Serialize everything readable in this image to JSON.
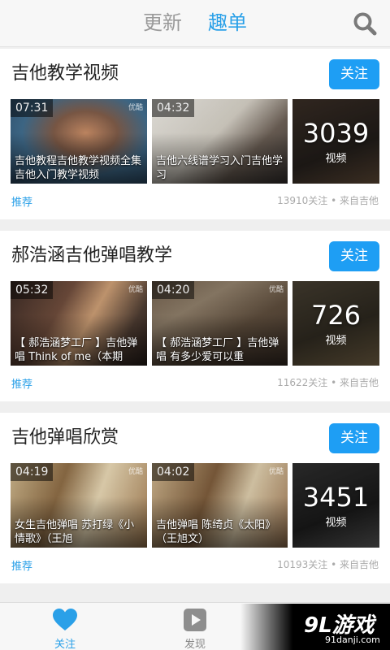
{
  "header": {
    "tab_update": "更新",
    "tab_list": "趣单",
    "accent": "#2aa0e8"
  },
  "cards": [
    {
      "title": "吉他教学视频",
      "follow_label": "关注",
      "videos": [
        {
          "duration": "07:31",
          "logo": "优酷",
          "caption": "吉他教程吉他教学视频全集吉他入门教学视频"
        },
        {
          "duration": "04:32",
          "caption": "吉他六线谱学习入门吉他学习"
        }
      ],
      "video_count": "3039",
      "video_count_label": "视频",
      "tag": "推荐",
      "meta": "13910关注 • 来自吉他"
    },
    {
      "title": "郝浩涵吉他弹唱教学",
      "follow_label": "关注",
      "videos": [
        {
          "duration": "05:32",
          "logo": "优酷",
          "caption": "【 郝浩涵梦工厂 】吉他弹唱 Think of me（本期"
        },
        {
          "duration": "04:20",
          "logo": "优酷",
          "caption": "【 郝浩涵梦工厂 】吉他弹唱 有多少爱可以重"
        }
      ],
      "video_count": "726",
      "video_count_label": "视频",
      "tag": "推荐",
      "meta": "11622关注 • 来自吉他"
    },
    {
      "title": "吉他弹唱欣赏",
      "follow_label": "关注",
      "videos": [
        {
          "duration": "04:19",
          "logo": "优酷",
          "caption": "女生吉他弹唱 苏打绿《小情歌》（王旭"
        },
        {
          "duration": "04:02",
          "logo": "优酷",
          "caption": "吉他弹唱 陈绮贞《太阳》（王旭文）"
        }
      ],
      "video_count": "3451",
      "video_count_label": "视频",
      "tag": "推荐",
      "meta": "10193关注 • 来自吉他"
    }
  ],
  "bottom_nav": {
    "follow_label": "关注",
    "discover_label": "发现"
  },
  "watermark": {
    "logo": "9L游戏",
    "url": "91danji.com"
  }
}
